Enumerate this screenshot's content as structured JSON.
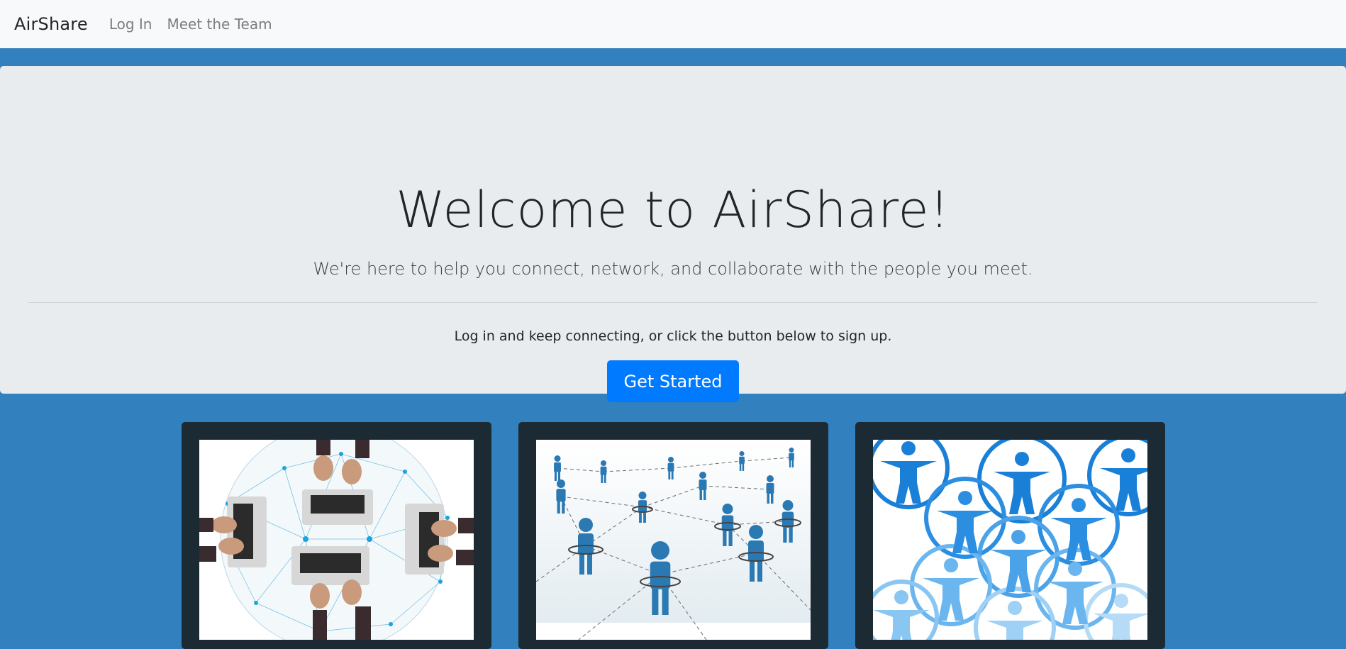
{
  "navbar": {
    "brand": "AirShare",
    "links": [
      {
        "label": "Log In"
      },
      {
        "label": "Meet the Team"
      }
    ]
  },
  "hero": {
    "title": "Welcome to AirShare!",
    "lead": "We're here to help you connect, network, and collaborate with the people you meet.",
    "prompt": "Log in and keep connecting, or click the button below to sign up.",
    "cta_label": "Get Started"
  },
  "cards": [
    {
      "image": "laptops-network-globe-image"
    },
    {
      "image": "people-network-figures-image"
    },
    {
      "image": "people-circles-icons-image"
    }
  ],
  "colors": {
    "page_background": "#3280bd",
    "navbar_background": "#f8f9fa",
    "jumbotron_background": "#e9ecef",
    "button_primary": "#007bff",
    "card_background": "#1c2a33"
  }
}
